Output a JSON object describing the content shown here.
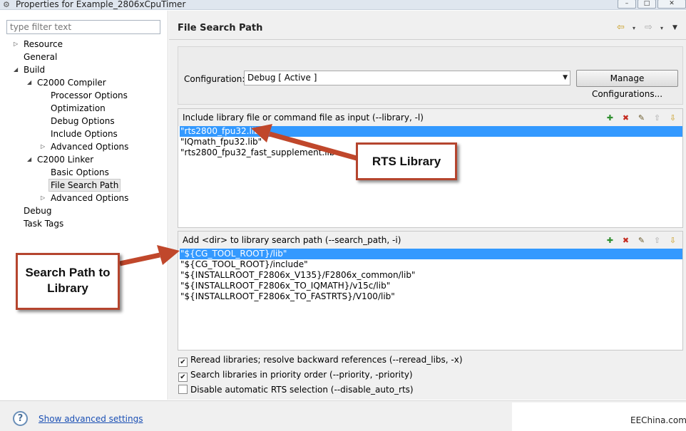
{
  "window": {
    "title": "Properties for Example_2806xCpuTimer",
    "controls": [
      "–",
      "□",
      "✕"
    ]
  },
  "left": {
    "filter_placeholder": "type filter text",
    "tree": [
      {
        "label": "Resource",
        "depth": 0,
        "twisty": "▷"
      },
      {
        "label": "General",
        "depth": 0,
        "twisty": ""
      },
      {
        "label": "Build",
        "depth": 0,
        "twisty": "◢"
      },
      {
        "label": "C2000 Compiler",
        "depth": 1,
        "twisty": "◢"
      },
      {
        "label": "Processor Options",
        "depth": 2,
        "twisty": ""
      },
      {
        "label": "Optimization",
        "depth": 2,
        "twisty": ""
      },
      {
        "label": "Debug Options",
        "depth": 2,
        "twisty": ""
      },
      {
        "label": "Include Options",
        "depth": 2,
        "twisty": ""
      },
      {
        "label": "Advanced Options",
        "depth": 2,
        "twisty": "▷"
      },
      {
        "label": "C2000 Linker",
        "depth": 1,
        "twisty": "◢"
      },
      {
        "label": "Basic Options",
        "depth": 2,
        "twisty": ""
      },
      {
        "label": "File Search Path",
        "depth": 2,
        "twisty": "",
        "selected": true
      },
      {
        "label": "Advanced Options",
        "depth": 2,
        "twisty": "▷"
      },
      {
        "label": "Debug",
        "depth": 0,
        "twisty": ""
      },
      {
        "label": "Task Tags",
        "depth": 0,
        "twisty": ""
      }
    ]
  },
  "page": {
    "title": "File Search Path",
    "nav": {
      "back": "⇦",
      "forward": "⇨",
      "menu": "▾",
      "view_menu": "▼"
    }
  },
  "config": {
    "label": "Configuration:",
    "value": "Debug  [ Active ]",
    "manage_label": "Manage Configurations..."
  },
  "lib_group": {
    "label": "Include library file or command file as input (--library, -l)",
    "tools": [
      "✚",
      "✖",
      "✎",
      "⇧",
      "⇩"
    ],
    "items": [
      {
        "text": "\"rts2800_fpu32.lib\"",
        "selected": true
      },
      {
        "text": "\"IQmath_fpu32.lib\"",
        "selected": false
      },
      {
        "text": "\"rts2800_fpu32_fast_supplement.lib",
        "selected": false
      }
    ]
  },
  "path_group": {
    "label": "Add <dir> to library search path (--search_path, -i)",
    "tools": [
      "✚",
      "✖",
      "✎",
      "⇧",
      "⇩"
    ],
    "items": [
      {
        "text": "\"${CG_TOOL_ROOT}/lib\"",
        "selected": true
      },
      {
        "text": "\"${CG_TOOL_ROOT}/include\"",
        "selected": false
      },
      {
        "text": "\"${INSTALLROOT_F2806x_V135}/F2806x_common/lib\"",
        "selected": false
      },
      {
        "text": "\"${INSTALLROOT_F2806x_TO_IQMATH}/v15c/lib\"",
        "selected": false
      },
      {
        "text": "\"${INSTALLROOT_F2806x_TO_FASTRTS}/V100/lib\"",
        "selected": false
      }
    ]
  },
  "checks": [
    {
      "label": "Reread libraries; resolve backward references (--reread_libs, -x)",
      "checked": true
    },
    {
      "label": "Search libraries in priority order (--priority, -priority)",
      "checked": true
    },
    {
      "label": "Disable automatic RTS selection (--disable_auto_rts)",
      "checked": false
    }
  ],
  "bottom": {
    "help_glyph": "?",
    "advanced_link": "Show advanced settings",
    "watermark": "EEChina.com"
  },
  "callouts": {
    "rts": "RTS Library",
    "search_line1": "Search Path to",
    "search_line2": "Library",
    "arrow_color": "#c0472b"
  }
}
